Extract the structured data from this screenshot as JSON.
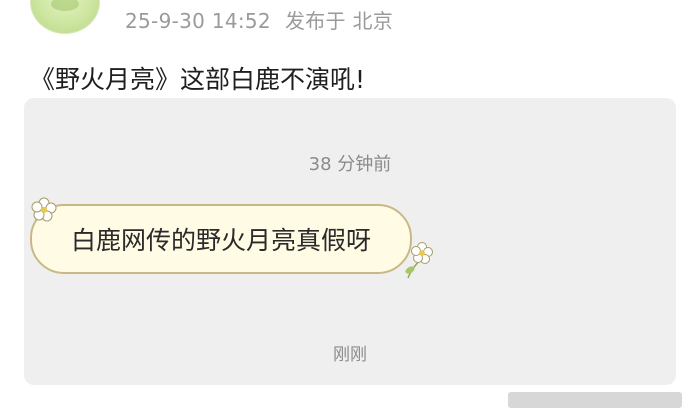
{
  "post": {
    "meta_time": "25-9-30 14:52",
    "meta_location": "发布于 北京",
    "text": "《野火月亮》这部白鹿不演吼!"
  },
  "chat": {
    "time_top": "38 分钟前",
    "message": "白鹿网传的野火月亮真假呀",
    "time_bottom": "刚刚"
  },
  "colors": {
    "card_background": "#efefef",
    "bubble_background": "#fffbe4",
    "bubble_border": "#c9b887",
    "meta_text": "#9a9a9a"
  },
  "icons": {
    "avatar": "avatar",
    "bubble_decor_left": "flower-icon",
    "bubble_decor_right": "flower-icon"
  }
}
